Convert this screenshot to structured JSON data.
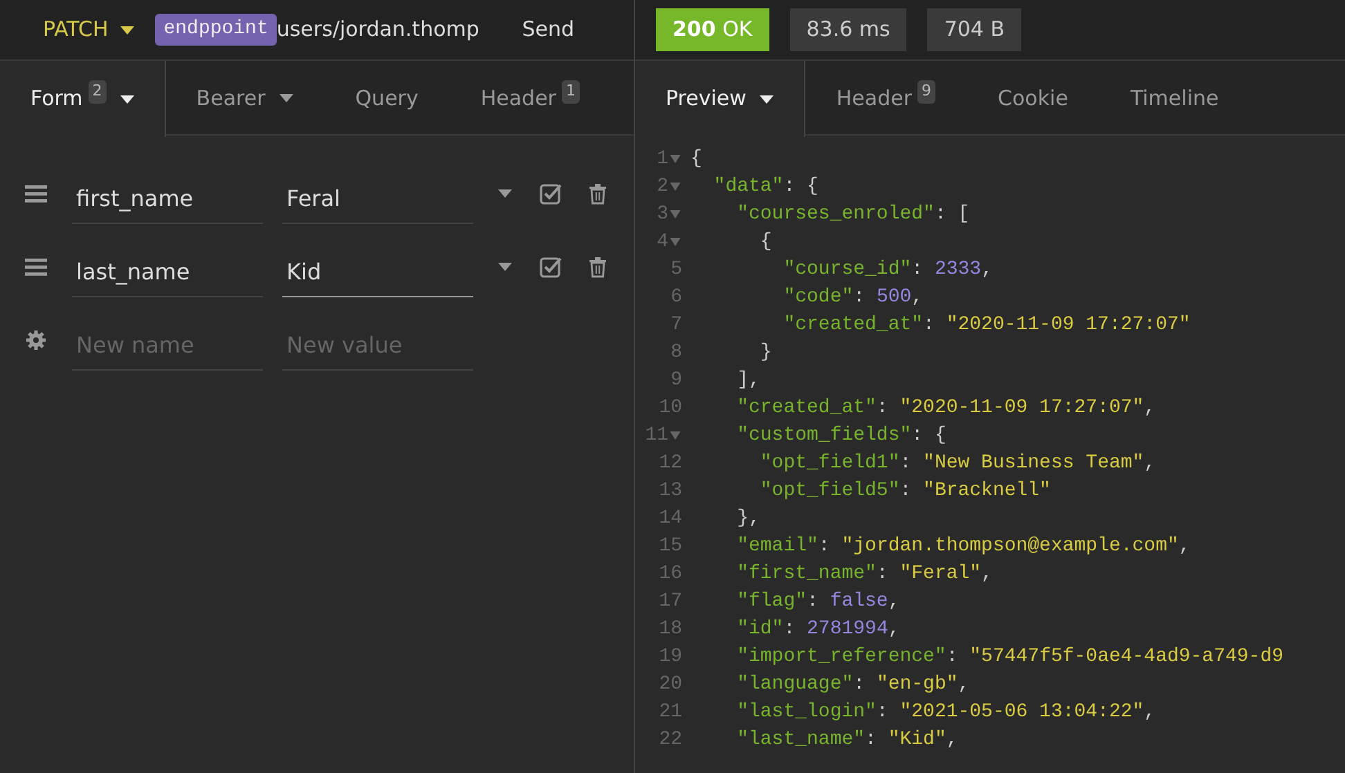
{
  "request": {
    "method": "PATCH",
    "tag": "endppoint",
    "url": "users/jordan.thomp",
    "send": "Send"
  },
  "response": {
    "status_code": "200",
    "status_text": "OK",
    "time": "83.6 ms",
    "size": "704 B"
  },
  "request_tabs": [
    {
      "label": "Form",
      "badge": "2",
      "dropdown": true,
      "selected": true
    },
    {
      "label": "Bearer",
      "dropdown": true,
      "selected": false
    },
    {
      "label": "Query",
      "dropdown": false,
      "selected": false
    },
    {
      "label": "Header",
      "badge": "1",
      "dropdown": false,
      "selected": false
    }
  ],
  "response_tabs": [
    {
      "label": "Preview",
      "dropdown": true,
      "selected": true
    },
    {
      "label": "Header",
      "badge": "9",
      "dropdown": false,
      "selected": false
    },
    {
      "label": "Cookie",
      "dropdown": false,
      "selected": false
    },
    {
      "label": "Timeline",
      "dropdown": false,
      "selected": false
    }
  ],
  "form_rows": [
    {
      "kind": "param",
      "name": "first_name",
      "value": "Feral",
      "checked": true,
      "focused": false
    },
    {
      "kind": "param",
      "name": "last_name",
      "value": "Kid",
      "checked": true,
      "focused": true
    },
    {
      "kind": "new",
      "name_placeholder": "New name",
      "value_placeholder": "New value"
    }
  ],
  "code_lines": [
    {
      "number": "1",
      "fold": true,
      "tokens": [
        {
          "kind": "punct",
          "text": "{"
        }
      ]
    },
    {
      "number": "2",
      "fold": true,
      "tokens": [
        {
          "kind": "key",
          "text": "  \"data\""
        },
        {
          "kind": "punct",
          "text": ": {"
        }
      ]
    },
    {
      "number": "3",
      "fold": true,
      "tokens": [
        {
          "kind": "key",
          "text": "    \"courses_enroled\""
        },
        {
          "kind": "punct",
          "text": ": ["
        }
      ]
    },
    {
      "number": "4",
      "fold": true,
      "tokens": [
        {
          "kind": "punct",
          "text": "      {"
        }
      ]
    },
    {
      "number": "5",
      "fold": false,
      "tokens": [
        {
          "kind": "key",
          "text": "        \"course_id\""
        },
        {
          "kind": "punct",
          "text": ": "
        },
        {
          "kind": "num",
          "text": "2333"
        },
        {
          "kind": "punct",
          "text": ","
        }
      ]
    },
    {
      "number": "6",
      "fold": false,
      "tokens": [
        {
          "kind": "key",
          "text": "        \"code\""
        },
        {
          "kind": "punct",
          "text": ": "
        },
        {
          "kind": "num",
          "text": "500"
        },
        {
          "kind": "punct",
          "text": ","
        }
      ]
    },
    {
      "number": "7",
      "fold": false,
      "tokens": [
        {
          "kind": "key",
          "text": "        \"created_at\""
        },
        {
          "kind": "punct",
          "text": ": "
        },
        {
          "kind": "str",
          "text": "\"2020-11-09 17:27:07\""
        }
      ]
    },
    {
      "number": "8",
      "fold": false,
      "tokens": [
        {
          "kind": "punct",
          "text": "      }"
        }
      ]
    },
    {
      "number": "9",
      "fold": false,
      "tokens": [
        {
          "kind": "punct",
          "text": "    ],"
        }
      ]
    },
    {
      "number": "10",
      "fold": false,
      "tokens": [
        {
          "kind": "key",
          "text": "    \"created_at\""
        },
        {
          "kind": "punct",
          "text": ": "
        },
        {
          "kind": "str",
          "text": "\"2020-11-09 17:27:07\""
        },
        {
          "kind": "punct",
          "text": ","
        }
      ]
    },
    {
      "number": "11",
      "fold": true,
      "tokens": [
        {
          "kind": "key",
          "text": "    \"custom_fields\""
        },
        {
          "kind": "punct",
          "text": ": {"
        }
      ]
    },
    {
      "number": "12",
      "fold": false,
      "tokens": [
        {
          "kind": "key",
          "text": "      \"opt_field1\""
        },
        {
          "kind": "punct",
          "text": ": "
        },
        {
          "kind": "str",
          "text": "\"New Business Team\""
        },
        {
          "kind": "punct",
          "text": ","
        }
      ]
    },
    {
      "number": "13",
      "fold": false,
      "tokens": [
        {
          "kind": "key",
          "text": "      \"opt_field5\""
        },
        {
          "kind": "punct",
          "text": ": "
        },
        {
          "kind": "str",
          "text": "\"Bracknell\""
        }
      ]
    },
    {
      "number": "14",
      "fold": false,
      "tokens": [
        {
          "kind": "punct",
          "text": "    },"
        }
      ]
    },
    {
      "number": "15",
      "fold": false,
      "tokens": [
        {
          "kind": "key",
          "text": "    \"email\""
        },
        {
          "kind": "punct",
          "text": ": "
        },
        {
          "kind": "str",
          "text": "\"jordan.thompson@example.com\""
        },
        {
          "kind": "punct",
          "text": ","
        }
      ]
    },
    {
      "number": "16",
      "fold": false,
      "tokens": [
        {
          "kind": "key",
          "text": "    \"first_name\""
        },
        {
          "kind": "punct",
          "text": ": "
        },
        {
          "kind": "str",
          "text": "\"Feral\""
        },
        {
          "kind": "punct",
          "text": ","
        }
      ]
    },
    {
      "number": "17",
      "fold": false,
      "tokens": [
        {
          "kind": "key",
          "text": "    \"flag\""
        },
        {
          "kind": "punct",
          "text": ": "
        },
        {
          "kind": "num",
          "text": "false"
        },
        {
          "kind": "punct",
          "text": ","
        }
      ]
    },
    {
      "number": "18",
      "fold": false,
      "tokens": [
        {
          "kind": "key",
          "text": "    \"id\""
        },
        {
          "kind": "punct",
          "text": ": "
        },
        {
          "kind": "num",
          "text": "2781994"
        },
        {
          "kind": "punct",
          "text": ","
        }
      ]
    },
    {
      "number": "19",
      "fold": false,
      "tokens": [
        {
          "kind": "key",
          "text": "    \"import_reference\""
        },
        {
          "kind": "punct",
          "text": ": "
        },
        {
          "kind": "str",
          "text": "\"57447f5f-0ae4-4ad9-a749-d9"
        }
      ]
    },
    {
      "number": "20",
      "fold": false,
      "tokens": [
        {
          "kind": "key",
          "text": "    \"language\""
        },
        {
          "kind": "punct",
          "text": ": "
        },
        {
          "kind": "str",
          "text": "\"en-gb\""
        },
        {
          "kind": "punct",
          "text": ","
        }
      ]
    },
    {
      "number": "21",
      "fold": false,
      "tokens": [
        {
          "kind": "key",
          "text": "    \"last_login\""
        },
        {
          "kind": "punct",
          "text": ": "
        },
        {
          "kind": "str",
          "text": "\"2021-05-06 13:04:22\""
        },
        {
          "kind": "punct",
          "text": ","
        }
      ]
    },
    {
      "number": "22",
      "fold": false,
      "tokens": [
        {
          "kind": "key",
          "text": "    \"last_name\""
        },
        {
          "kind": "punct",
          "text": ": "
        },
        {
          "kind": "str",
          "text": "\"Kid\""
        },
        {
          "kind": "punct",
          "text": ","
        }
      ]
    }
  ]
}
